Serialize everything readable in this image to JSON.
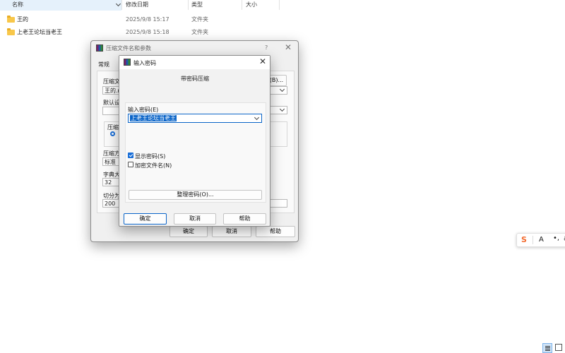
{
  "explorer": {
    "columns": {
      "name": "名称",
      "modified": "修改日期",
      "type": "类型",
      "size": "大小"
    },
    "rows": [
      {
        "name": "王的",
        "modified": "2025/9/8 15:17",
        "type": "文件夹"
      },
      {
        "name": "上老王论坛当老王",
        "modified": "2025/9/8 15:18",
        "type": "文件夹"
      }
    ]
  },
  "archive_dialog": {
    "title": "压缩文件名和参数",
    "help_symbol": "?",
    "tab_general": "常规",
    "label_archive_name": "压缩文",
    "archive_name_value": "王的.r",
    "browse_button": "(B)...",
    "label_profile": "默认设",
    "label_format": "压缩",
    "label_method": "压缩方",
    "method_value": "标准",
    "label_dict": "字典大",
    "dict_value": "32",
    "label_split": "切分为",
    "split_value": "200",
    "ok": "确定",
    "cancel": "取消",
    "help": "帮助"
  },
  "password_dialog": {
    "title": "输入密码",
    "heading": "带密码压缩",
    "label_password": "输入密码(E)",
    "password_value": "上老王论坛当老王",
    "show_password": "显示密码(S)",
    "show_password_checked": true,
    "encrypt_names": "加密文件名(N)",
    "encrypt_names_checked": false,
    "organize_button": "整理密码(O)...",
    "ok": "确定",
    "cancel": "取消",
    "help": "帮助"
  },
  "ime": {
    "logo": "S",
    "half_width": "A"
  }
}
